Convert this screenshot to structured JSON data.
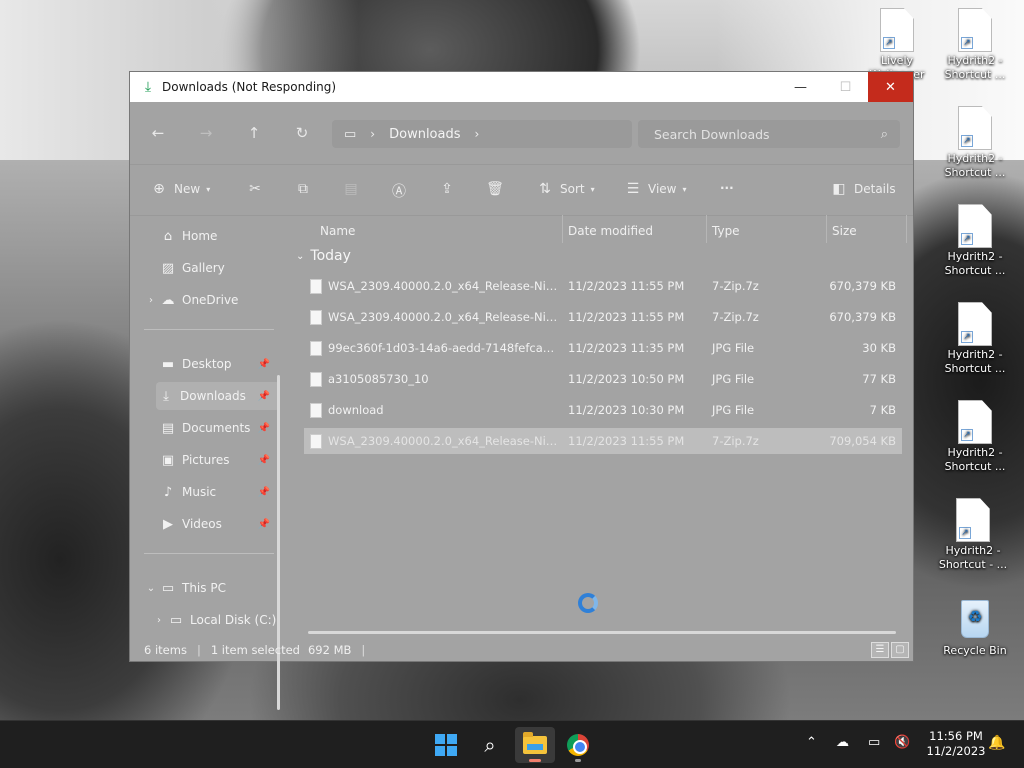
{
  "desktop": {
    "icons": [
      {
        "label": "Lively\nWallpaper"
      },
      {
        "label": "Hydrith2 -\nShortcut ..."
      },
      {
        "label": "Hydrith2 -\nShortcut ..."
      },
      {
        "label": "Hydrith2 -\nShortcut ..."
      },
      {
        "label": "Hydrith2 -\nShortcut ..."
      },
      {
        "label": "Hydrith2 -\nShortcut ..."
      },
      {
        "label": "Hydrith2 -\nShortcut - ..."
      },
      {
        "label": "Recycle Bin"
      }
    ]
  },
  "window": {
    "title": "Downloads (Not Responding)",
    "controls": {
      "minimize": "—",
      "maximize": "☐",
      "close": "✕"
    },
    "address": {
      "crumb": "Downloads"
    },
    "search": {
      "placeholder": "Search Downloads"
    },
    "toolbar": {
      "new": "New",
      "sort": "Sort",
      "view": "View",
      "more": "···",
      "details": "Details"
    },
    "sidebar": {
      "items": [
        {
          "label": "Home",
          "icon": "home-icon"
        },
        {
          "label": "Gallery",
          "icon": "gallery-icon"
        },
        {
          "label": "OneDrive",
          "icon": "cloud-icon"
        },
        {
          "label": "Desktop",
          "icon": "desktop-icon"
        },
        {
          "label": "Downloads",
          "icon": "download-icon"
        },
        {
          "label": "Documents",
          "icon": "documents-icon"
        },
        {
          "label": "Pictures",
          "icon": "pictures-icon"
        },
        {
          "label": "Music",
          "icon": "music-icon"
        },
        {
          "label": "Videos",
          "icon": "videos-icon"
        },
        {
          "label": "This PC",
          "icon": "pc-icon"
        },
        {
          "label": "Local Disk (C:)",
          "icon": "disk-icon"
        }
      ]
    },
    "columns": {
      "name": "Name",
      "date": "Date modified",
      "type": "Type",
      "size": "Size"
    },
    "group": "Today",
    "files": [
      {
        "name": "WSA_2309.40000.2.0_x64_Release-Nightly...",
        "date": "11/2/2023 11:55 PM",
        "type": "7-Zip.7z",
        "size": "670,379 KB"
      },
      {
        "name": "WSA_2309.40000.2.0_x64_Release-Nightly...",
        "date": "11/2/2023 11:55 PM",
        "type": "7-Zip.7z",
        "size": "670,379 KB"
      },
      {
        "name": "99ec360f-1d03-14a6-aedd-7148fefca520",
        "date": "11/2/2023 11:35 PM",
        "type": "JPG File",
        "size": "30 KB"
      },
      {
        "name": "a3105085730_10",
        "date": "11/2/2023 10:50 PM",
        "type": "JPG File",
        "size": "77 KB"
      },
      {
        "name": "download",
        "date": "11/2/2023 10:30 PM",
        "type": "JPG File",
        "size": "7 KB"
      },
      {
        "name": "WSA_2309.40000.2.0_x64_Release-Nightly...",
        "date": "11/2/2023 11:55 PM",
        "type": "7-Zip.7z",
        "size": "709,054 KB"
      }
    ],
    "status": {
      "count": "6 items",
      "selected": "1 item selected",
      "size": "692 MB"
    }
  },
  "taskbar": {
    "clock_time": "11:56 PM",
    "clock_date": "11/2/2023"
  }
}
